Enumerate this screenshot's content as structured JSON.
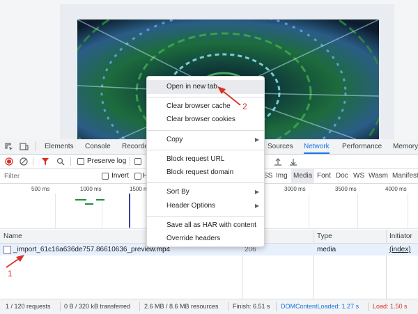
{
  "devtools": {
    "tabs": [
      {
        "label": "Elements"
      },
      {
        "label": "Console"
      },
      {
        "label": "Recorde"
      },
      {
        "label": "Sources"
      },
      {
        "label": "Network"
      },
      {
        "label": "Performance"
      },
      {
        "label": "Memory"
      }
    ],
    "active_tab": "Network",
    "toolbar": {
      "preserve_log": "Preserve log"
    },
    "filter": {
      "placeholder": "Filter",
      "invert": "Invert",
      "h_partial": "H",
      "types": [
        "SS",
        "Img",
        "Media",
        "Font",
        "Doc",
        "WS",
        "Wasm",
        "Manifest"
      ],
      "selected_type": "Media"
    },
    "timeline": {
      "ticks": [
        "500 ms",
        "1000 ms",
        "1500 ms",
        "3000 ms",
        "3500 ms",
        "4000 ms"
      ]
    },
    "table": {
      "headers": {
        "name": "Name",
        "type": "Type",
        "initiator": "Initiator"
      },
      "rows": [
        {
          "name": "_import_61c16a636de757.86610636_preview.mp4",
          "status": "206",
          "type": "media",
          "initiator": "(index)"
        }
      ]
    },
    "status": {
      "requests": "1 / 120 requests",
      "transferred": "0 B / 320 kB transferred",
      "resources": "2.6 MB / 8.6 MB resources",
      "finish": "Finish: 6.51 s",
      "domcontent": "DOMContentLoaded: 1.27 s",
      "load": "Load: 1.50 s"
    }
  },
  "context_menu": {
    "items": [
      {
        "label": "Open in new tab",
        "highlight": true
      },
      {
        "label": "Clear browser cache"
      },
      {
        "label": "Clear browser cookies"
      },
      {
        "label": "Copy",
        "submenu": true
      },
      {
        "label": "Block request URL"
      },
      {
        "label": "Block request domain"
      },
      {
        "label": "Sort By",
        "submenu": true
      },
      {
        "label": "Header Options",
        "submenu": true
      },
      {
        "label": "Save all as HAR with content"
      },
      {
        "label": "Override headers"
      }
    ]
  },
  "annotations": {
    "step1": "1",
    "step2": "2"
  },
  "colors": {
    "accent": "#1a73e8",
    "record": "#d93025",
    "annotation": "#d93025"
  }
}
